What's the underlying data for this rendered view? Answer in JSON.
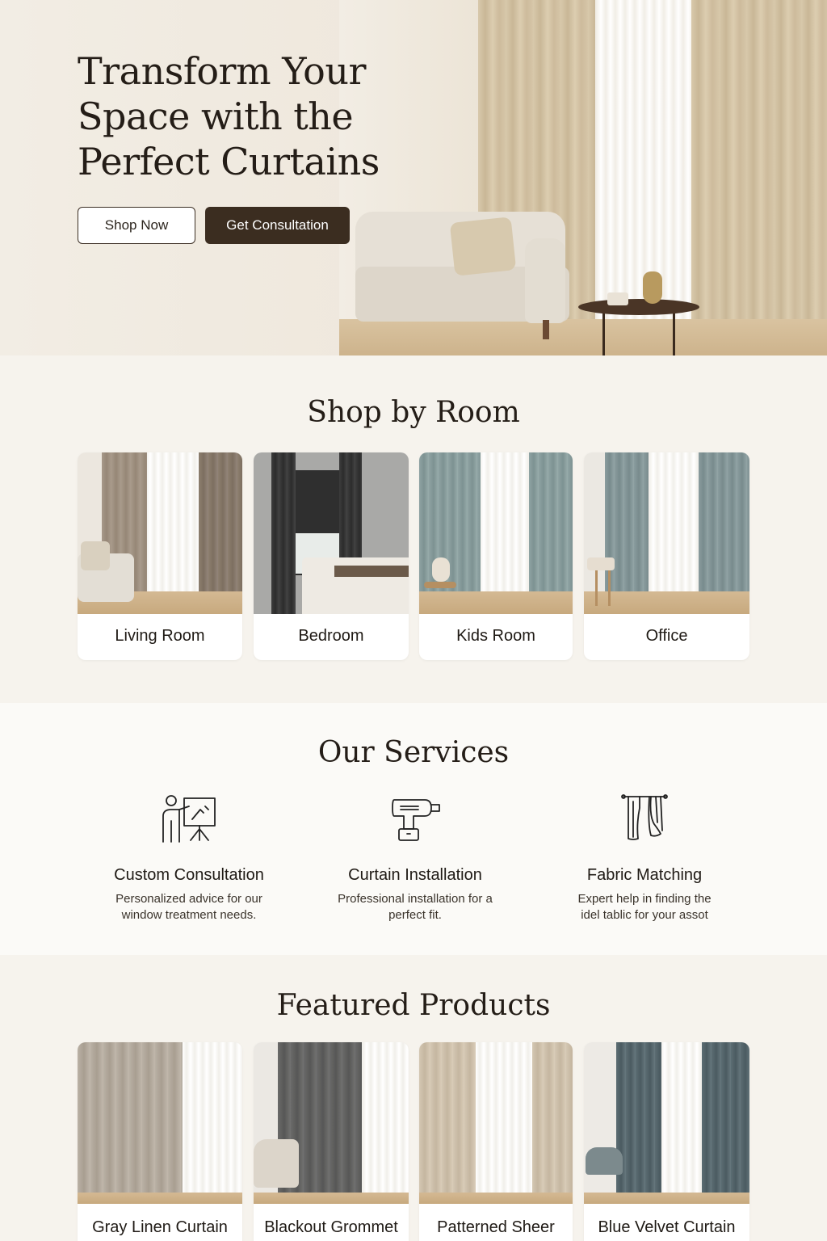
{
  "hero": {
    "title": "Transform Your Space with the Perfect Curtains",
    "shop_button": "Shop Now",
    "consult_button": "Get Consultation"
  },
  "rooms": {
    "title": "Shop by Room",
    "items": [
      {
        "label": "Living Room"
      },
      {
        "label": "Bedroom"
      },
      {
        "label": "Kids Room"
      },
      {
        "label": "Office"
      }
    ]
  },
  "services": {
    "title": "Our Services",
    "items": [
      {
        "icon": "presentation-icon",
        "title": "Custom Consultation",
        "desc": "Personalized advice for our window treatment needs."
      },
      {
        "icon": "drill-icon",
        "title": "Curtain Installation",
        "desc": "Professional installation for a perfect fit."
      },
      {
        "icon": "curtain-icon",
        "title": "Fabric Matching",
        "desc": "Expert help in finding the idel tablic for your assot"
      }
    ]
  },
  "featured": {
    "title": "Featured Products",
    "items": [
      {
        "label": "Gray Linen Curtain"
      },
      {
        "label": "Blackout Grommet"
      },
      {
        "label": "Patterned Sheer"
      },
      {
        "label": "Blue Velvet Curtain"
      }
    ]
  },
  "colors": {
    "primary_dark": "#3b2d20",
    "background": "#f6f3ed",
    "text": "#241d17"
  }
}
